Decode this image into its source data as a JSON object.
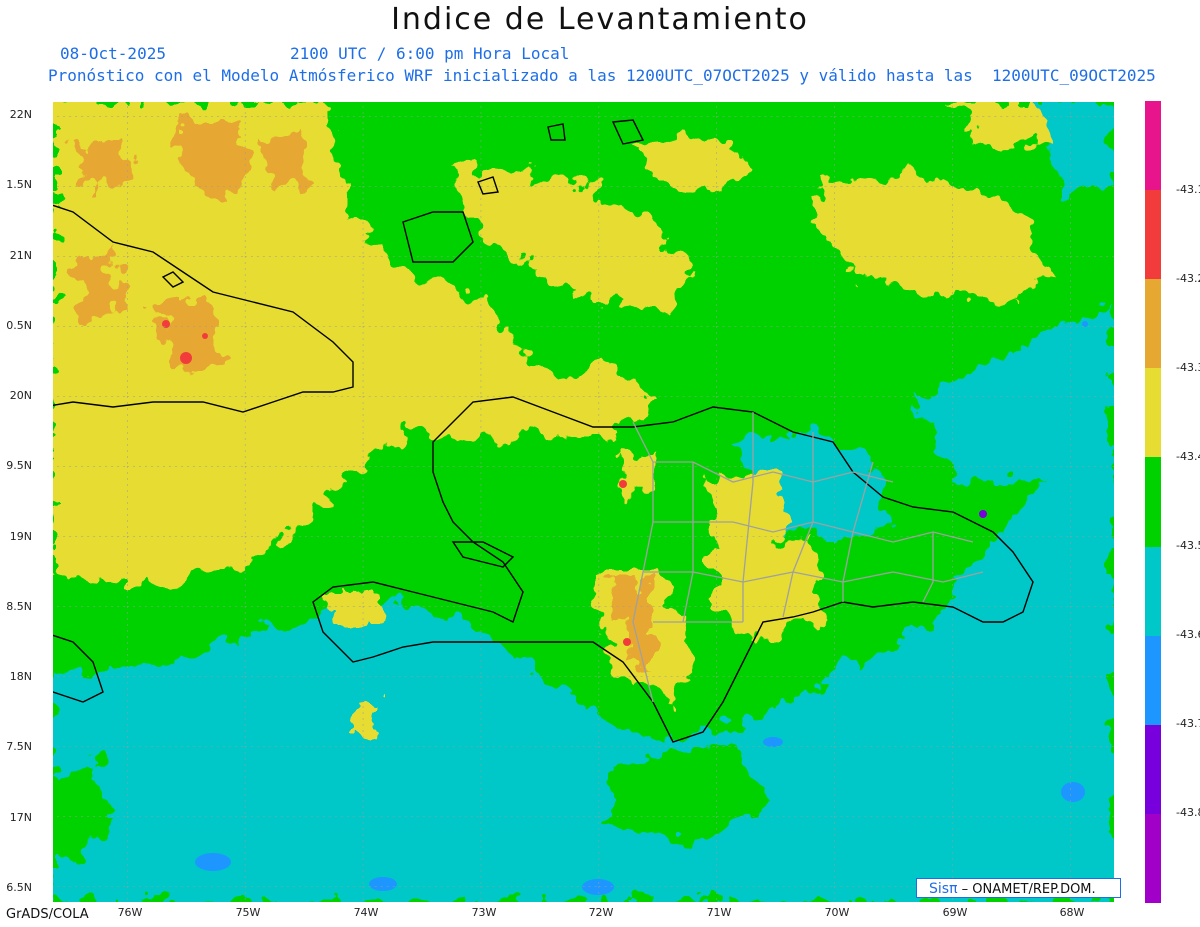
{
  "title": "Indice de Levantamiento",
  "date": "08-Oct-2025",
  "time_line": "2100 UTC / 6:00 pm Hora Local",
  "model_line": "Pronóstico con el Modelo Atmósferico WRF inicializado a las 1200UTC_07OCT2025 y válido hasta las  1200UTC_09OCT2025",
  "lat_labels": [
    "22N",
    "1.5N",
    "21N",
    "0.5N",
    "20N",
    "9.5N",
    "19N",
    "8.5N",
    "18N",
    "7.5N",
    "17N",
    "6.5N"
  ],
  "lon_labels": [
    "76W",
    "75W",
    "74W",
    "73W",
    "72W",
    "71W",
    "70W",
    "69W",
    "68W"
  ],
  "colorbar": {
    "labels": [
      "-43.1",
      "-43.2",
      "-43.3",
      "-43.4",
      "-43.5",
      "-43.6",
      "-43.7",
      "-43.8"
    ],
    "colors": [
      "#e8148c",
      "#f23c3c",
      "#e6a830",
      "#e6dc32",
      "#00d200",
      "#00c8c8",
      "#1e96ff",
      "#7800dc",
      "#a000c8"
    ]
  },
  "credit": {
    "sis": "Sisπ",
    "text": "– ONAMET/REP.DOM."
  },
  "footer": "GrADS/COLA"
}
